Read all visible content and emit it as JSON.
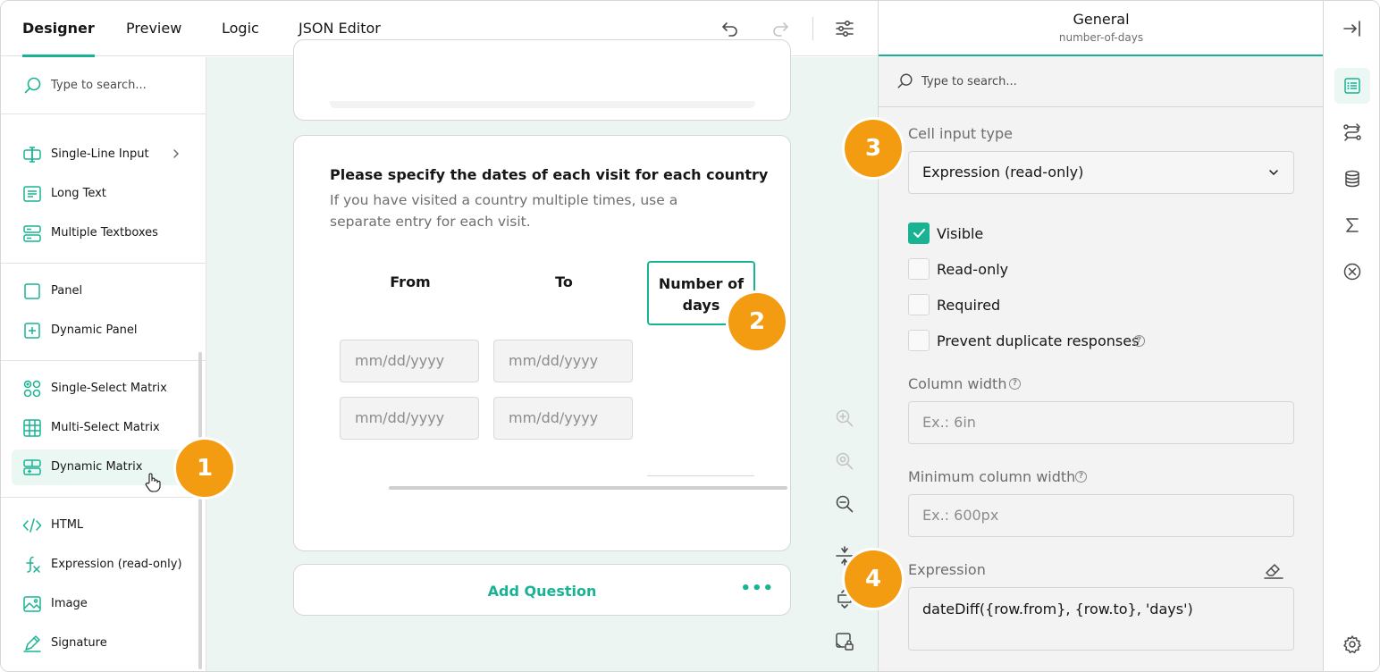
{
  "topbar": {
    "tabs": [
      "Designer",
      "Preview",
      "Logic",
      "JSON Editor"
    ],
    "active_tab": "Designer"
  },
  "toolbox": {
    "search_placeholder": "Type to search...",
    "items": [
      {
        "label": "Single-Line Input",
        "icon": "text-cursor-icon",
        "has_submenu": true
      },
      {
        "label": "Long Text",
        "icon": "long-text-icon"
      },
      {
        "label": "Multiple Textboxes",
        "icon": "multiple-textboxes-icon"
      },
      {
        "label": "Panel",
        "icon": "panel-icon"
      },
      {
        "label": "Dynamic Panel",
        "icon": "dynamic-panel-icon"
      },
      {
        "label": "Single-Select Matrix",
        "icon": "single-select-matrix-icon"
      },
      {
        "label": "Multi-Select Matrix",
        "icon": "multi-select-matrix-icon"
      },
      {
        "label": "Dynamic Matrix",
        "icon": "dynamic-matrix-icon",
        "selected": true
      },
      {
        "label": "HTML",
        "icon": "html-icon"
      },
      {
        "label": "Expression (read-only)",
        "icon": "expression-icon"
      },
      {
        "label": "Image",
        "icon": "image-icon"
      },
      {
        "label": "Signature",
        "icon": "signature-icon"
      }
    ]
  },
  "canvas": {
    "question": {
      "title": "Please specify the dates of each visit for each country",
      "description": "If you have visited a country multiple times, use a separate entry for each visit.",
      "columns": [
        "From",
        "To",
        "Number of days"
      ],
      "date_placeholder": "mm/dd/yyyy"
    },
    "add_question_label": "Add Question",
    "more_label": "•••"
  },
  "property_grid": {
    "header_title": "General",
    "header_subtitle": "number-of-days",
    "search_placeholder": "Type to search...",
    "cell_input_type_label": "Cell input type",
    "cell_input_type_value": "Expression (read-only)",
    "checkboxes": [
      {
        "label": "Visible",
        "checked": true
      },
      {
        "label": "Read-only",
        "checked": false
      },
      {
        "label": "Required",
        "checked": false
      },
      {
        "label": "Prevent duplicate responses",
        "checked": false
      }
    ],
    "column_width_label": "Column width",
    "column_width_placeholder": "Ex.: 6in",
    "min_column_width_label": "Minimum column width",
    "min_column_width_placeholder": "Ex.: 600px",
    "expression_label": "Expression",
    "expression_value": "dateDiff({row.from}, {row.to}, 'days')"
  },
  "badges": [
    "1",
    "2",
    "3",
    "4"
  ],
  "colors": {
    "accent": "#19b394",
    "badge": "#f39c12",
    "canvas_bg": "#edf5f3"
  }
}
